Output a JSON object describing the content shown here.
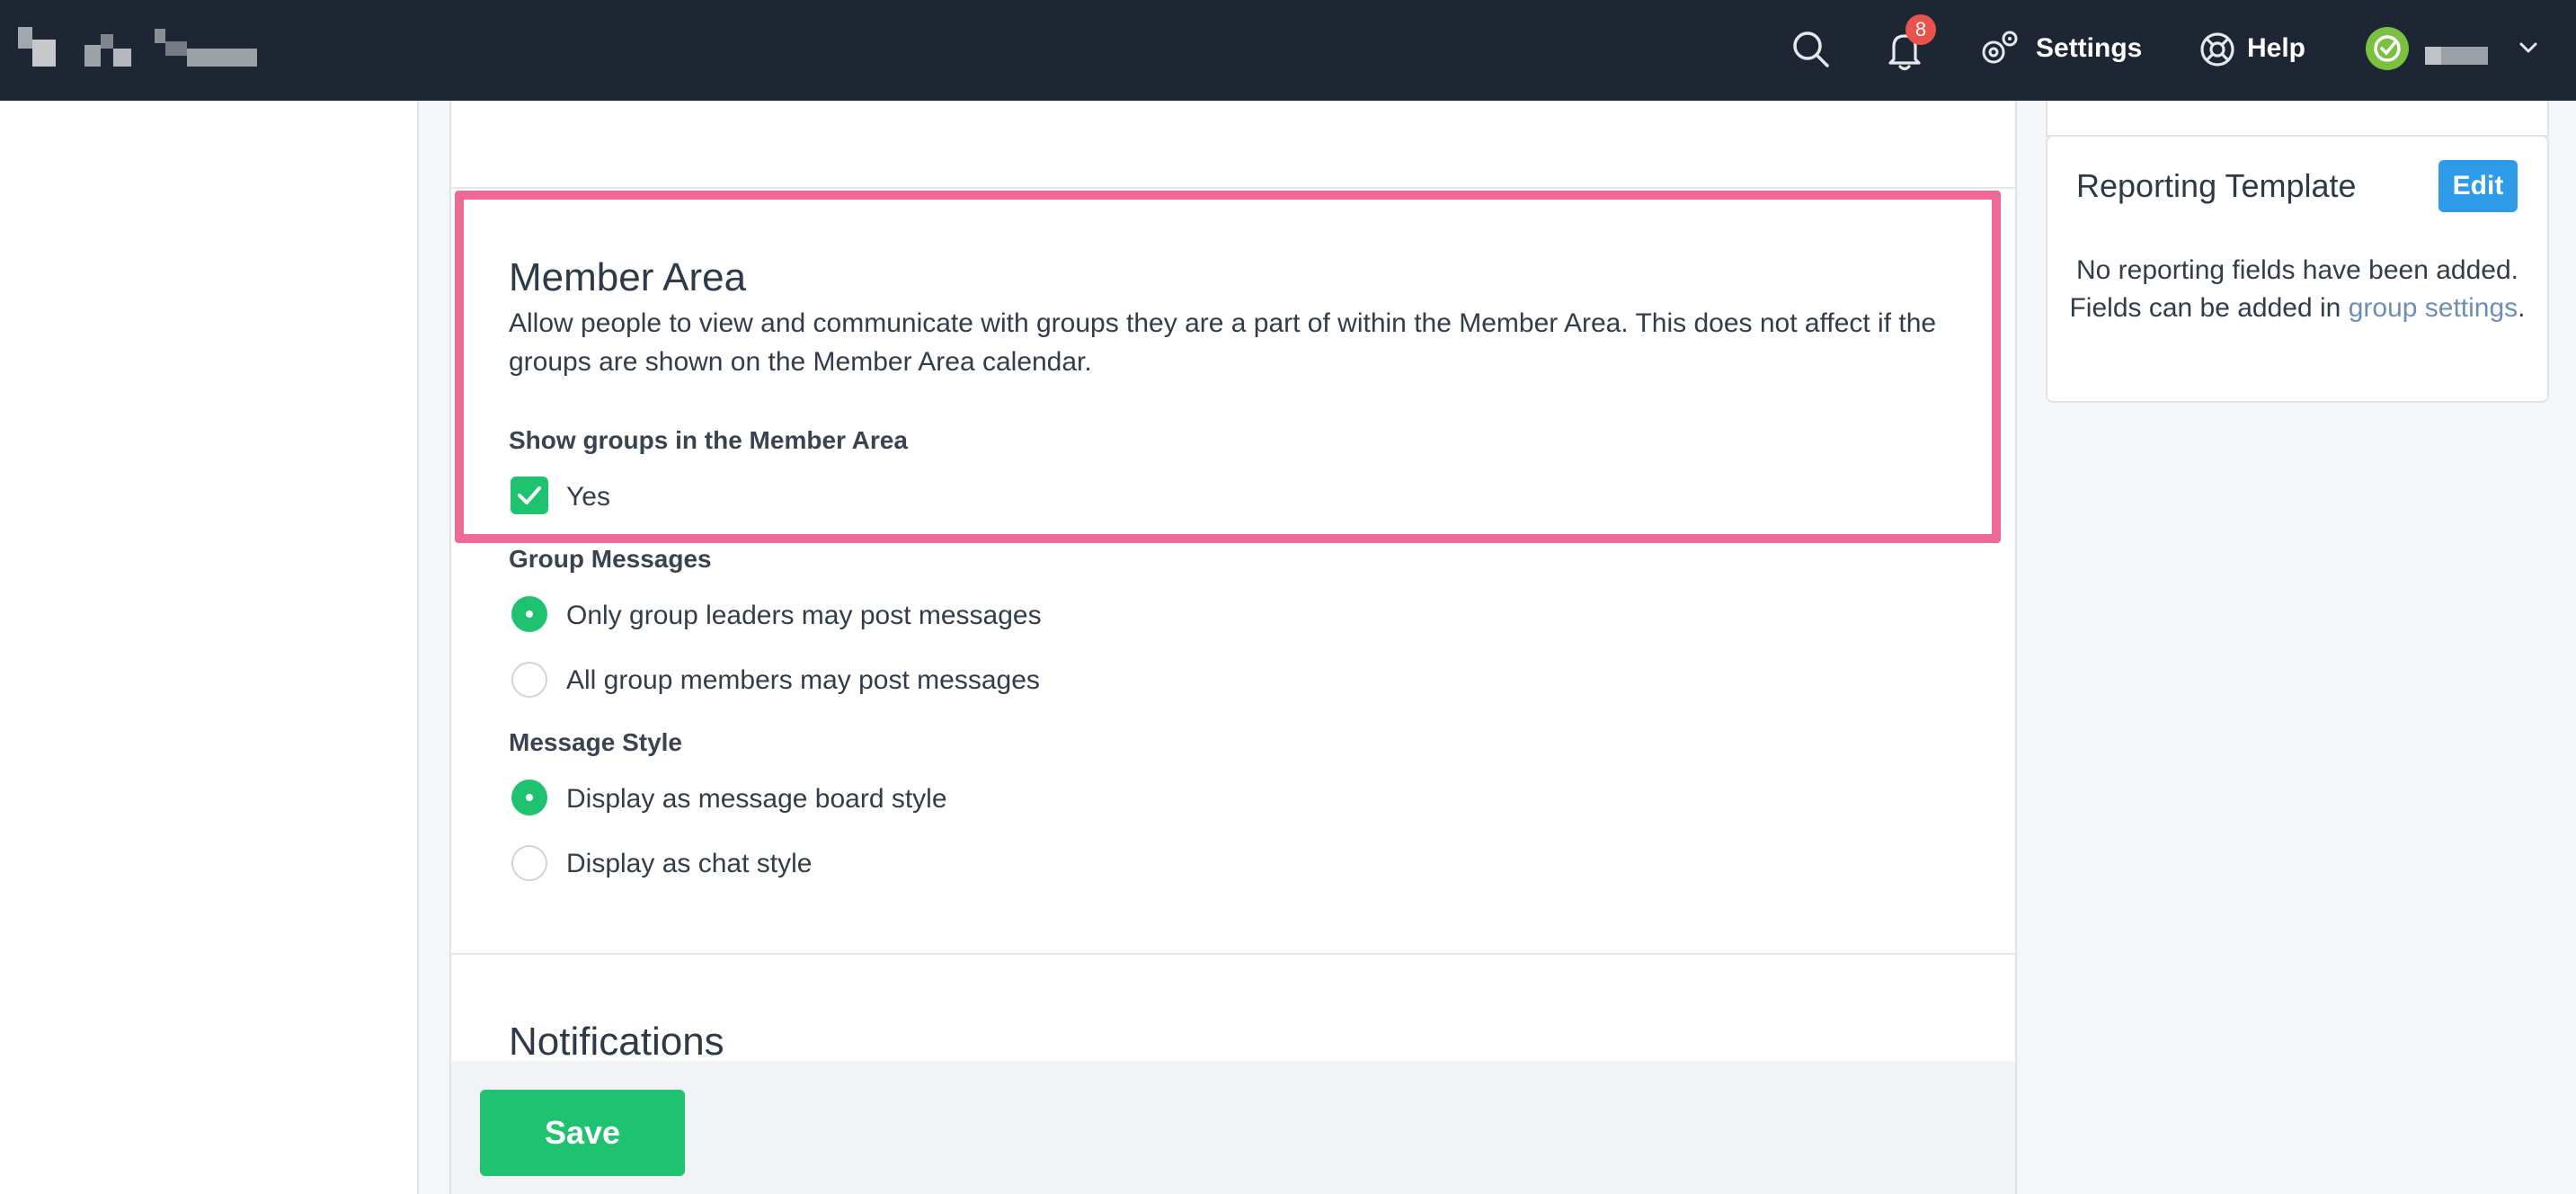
{
  "topbar": {
    "notification_count": "8",
    "settings_label": "Settings",
    "help_label": "Help",
    "icons": [
      "search-icon",
      "bell-icon",
      "gear-icon",
      "lifebuoy-icon",
      "chevron-down-icon"
    ]
  },
  "member_area": {
    "title": "Member Area",
    "description": "Allow people to view and communicate with groups they are a part of within the Member Area. This does not affect if the groups are shown on the Member Area calendar.",
    "show_groups_label": "Show groups in the Member Area",
    "show_groups_option": "Yes",
    "show_groups_checked": true
  },
  "group_messages": {
    "label": "Group Messages",
    "options": [
      "Only group leaders may post messages",
      "All group members may post messages"
    ],
    "selected": "Only group leaders may post messages"
  },
  "message_style": {
    "label": "Message Style",
    "options": [
      "Display as message board style",
      "Display as chat style"
    ],
    "selected": "Display as message board style"
  },
  "notifications": {
    "title": "Notifications"
  },
  "footer": {
    "save_label": "Save"
  },
  "reporting_template": {
    "title": "Reporting Template",
    "edit_label": "Edit",
    "text_before": "No reporting fields have been added. Fields can be added in ",
    "link_text": "group settings",
    "text_after": "."
  },
  "colors": {
    "topbar": "#1f2633",
    "accent_green": "#1fc36f",
    "highlight_pink": "#ec6a94",
    "edit_blue": "#2d9be8",
    "badge_red": "#e8544d"
  }
}
